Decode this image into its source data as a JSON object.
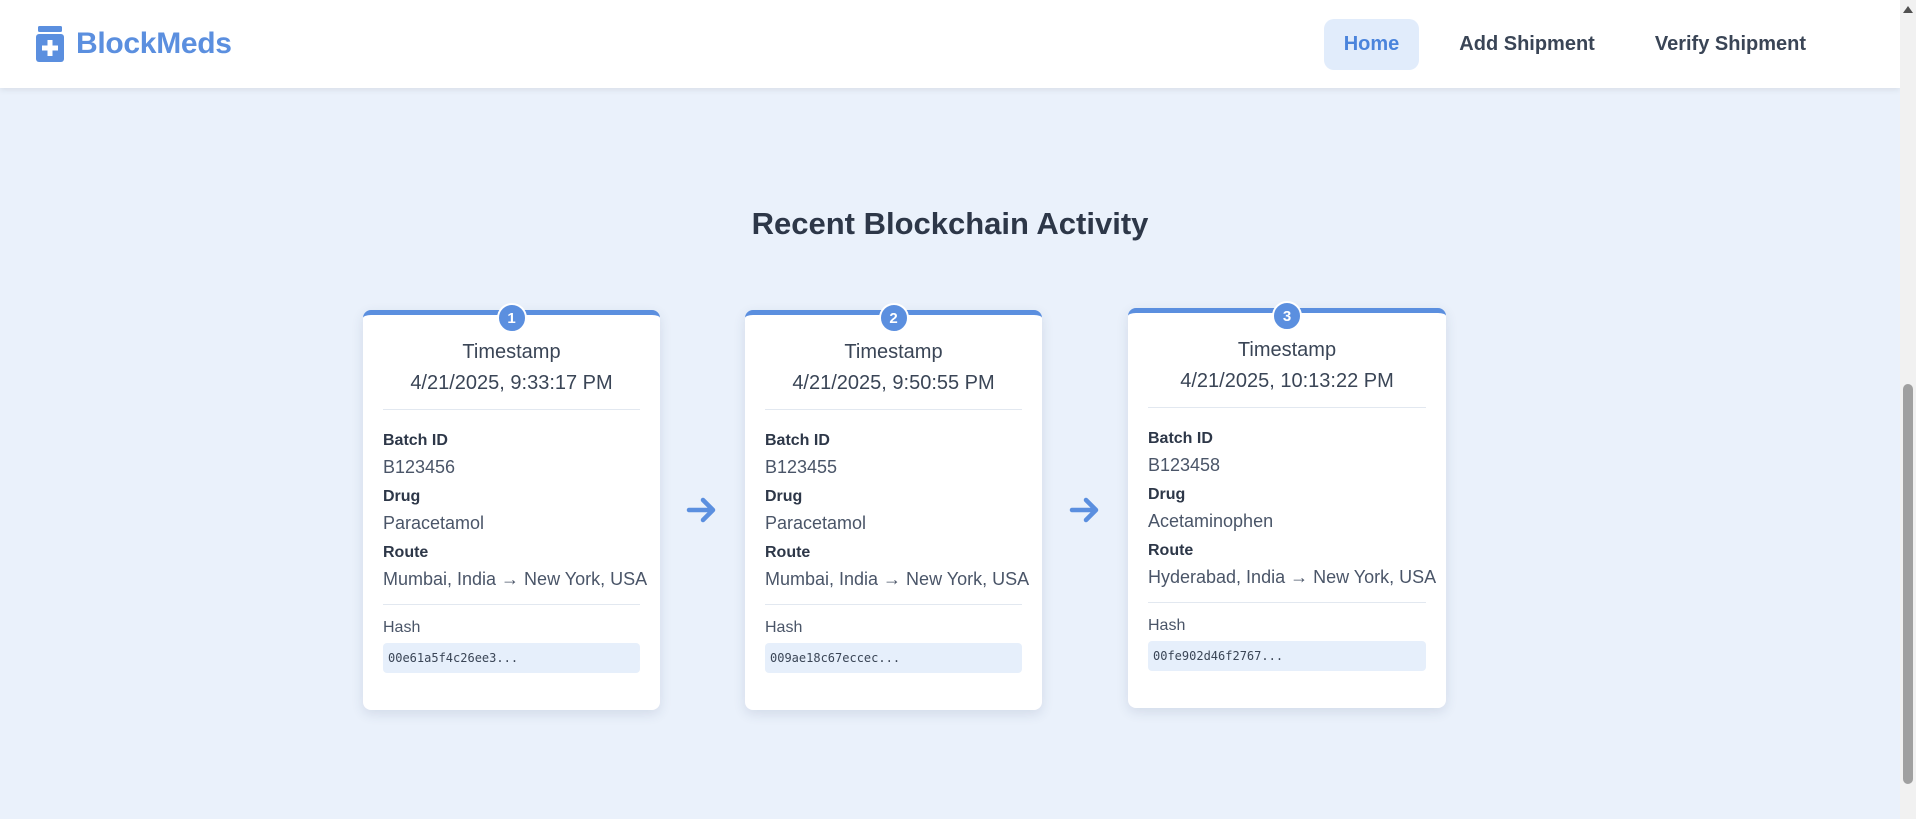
{
  "header": {
    "brand_name": "BlockMeds",
    "brand_icon": "medicine-bottle-icon",
    "nav": [
      {
        "label": "Home",
        "active": true
      },
      {
        "label": "Add Shipment",
        "active": false
      },
      {
        "label": "Verify Shipment",
        "active": false
      }
    ]
  },
  "section": {
    "title": "Recent Blockchain Activity"
  },
  "labels": {
    "timestamp": "Timestamp",
    "batch_id": "Batch ID",
    "drug": "Drug",
    "route": "Route",
    "hash": "Hash"
  },
  "blocks": [
    {
      "number": "1",
      "timestamp": "4/21/2025, 9:33:17 PM",
      "batch_id": "B123456",
      "drug": "Paracetamol",
      "route": "Mumbai, India → New York, USA",
      "hash": "00e61a5f4c26ee3..."
    },
    {
      "number": "2",
      "timestamp": "4/21/2025, 9:50:55 PM",
      "batch_id": "B123455",
      "drug": "Paracetamol",
      "route": "Mumbai, India → New York, USA",
      "hash": "009ae18c67eccec..."
    },
    {
      "number": "3",
      "timestamp": "4/21/2025, 10:13:22 PM",
      "batch_id": "B123458",
      "drug": "Acetaminophen",
      "route": "Hyderabad, India → New York, USA",
      "hash": "00fe902d46f2767..."
    }
  ],
  "connector_icon": "arrow-right-icon",
  "colors": {
    "accent": "#5b8fdf",
    "background": "#eaf1fb",
    "nav_active_bg": "#e1ecfb",
    "hash_bg": "#e6effb"
  }
}
